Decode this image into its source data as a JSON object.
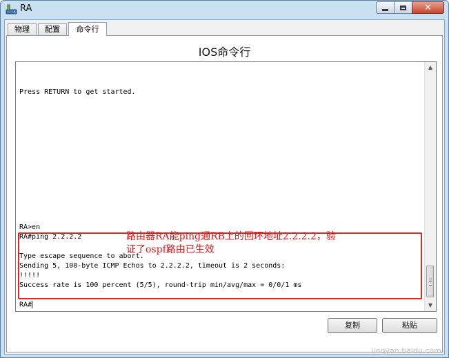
{
  "window": {
    "title": "RA",
    "icon": "router-icon"
  },
  "tabs": [
    {
      "label": "物理"
    },
    {
      "label": "配置"
    },
    {
      "label": "命令行"
    }
  ],
  "panel": {
    "title": "IOS命令行"
  },
  "terminal": {
    "lines": {
      "l1": "Press RETURN to get started.",
      "l2": "RA>en",
      "l3": "RA#ping 2.2.2.2",
      "l4": "Type escape sequence to abort.",
      "l5": "Sending 5, 100-byte ICMP Echos to 2.2.2.2, timeout is 2 seconds:",
      "l6": "!!!!!",
      "l7": "Success rate is 100 percent (5/5), round-trip min/avg/max = 0/0/1 ms",
      "prompt": "RA#"
    }
  },
  "annotation": {
    "line1": "路由器RA能ping通RB上的回环地址2.2.2.2，验",
    "line2": "证了ospf路由已生效",
    "color": "#e0181b"
  },
  "buttons": {
    "copy": "复制",
    "paste": "粘贴"
  },
  "watermark": "jingyan.baidu.com"
}
